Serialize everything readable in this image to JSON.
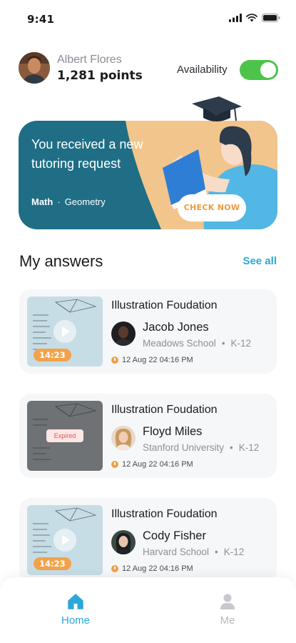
{
  "status_bar": {
    "time": "9:41",
    "icons": [
      "signal-icon",
      "wifi-icon",
      "battery-icon"
    ]
  },
  "profile": {
    "name": "Albert Flores",
    "points": "1,281 points",
    "availability_label": "Availability",
    "availability_on": true
  },
  "banner": {
    "title": "You received a new tutoring request",
    "tags": [
      "Math",
      "Geometry"
    ],
    "button_label": "CHECK NOW"
  },
  "answers": {
    "section_title": "My answers",
    "see_all_label": "See all",
    "items": [
      {
        "title": "Illustration Foudation",
        "tutor": "Jacob Jones",
        "school": "Meadows School",
        "grade": "K-12",
        "date": "12 Aug 22 04:16 PM",
        "duration": "14:23",
        "expired": false
      },
      {
        "title": "Illustration Foudation",
        "tutor": "Floyd Miles",
        "school": "Stanford University",
        "grade": "K-12",
        "date": "12 Aug 22 04:16 PM",
        "expired_label": "Expired",
        "expired": true
      },
      {
        "title": "Illustration Foudation",
        "tutor": "Cody Fisher",
        "school": "Harvard School",
        "grade": "K-12",
        "date": "12 Aug 22 04:16 PM",
        "duration": "14:23",
        "expired": false
      }
    ]
  },
  "bottom_nav": {
    "items": [
      {
        "label": "Home",
        "icon": "home-icon",
        "active": true
      },
      {
        "label": "Me",
        "icon": "person-icon",
        "active": false
      }
    ]
  },
  "colors": {
    "accent": "#2ba8d8",
    "banner_bg": "#1f6e86",
    "toggle_on": "#4cc44a",
    "orange": "#f4a24a"
  }
}
